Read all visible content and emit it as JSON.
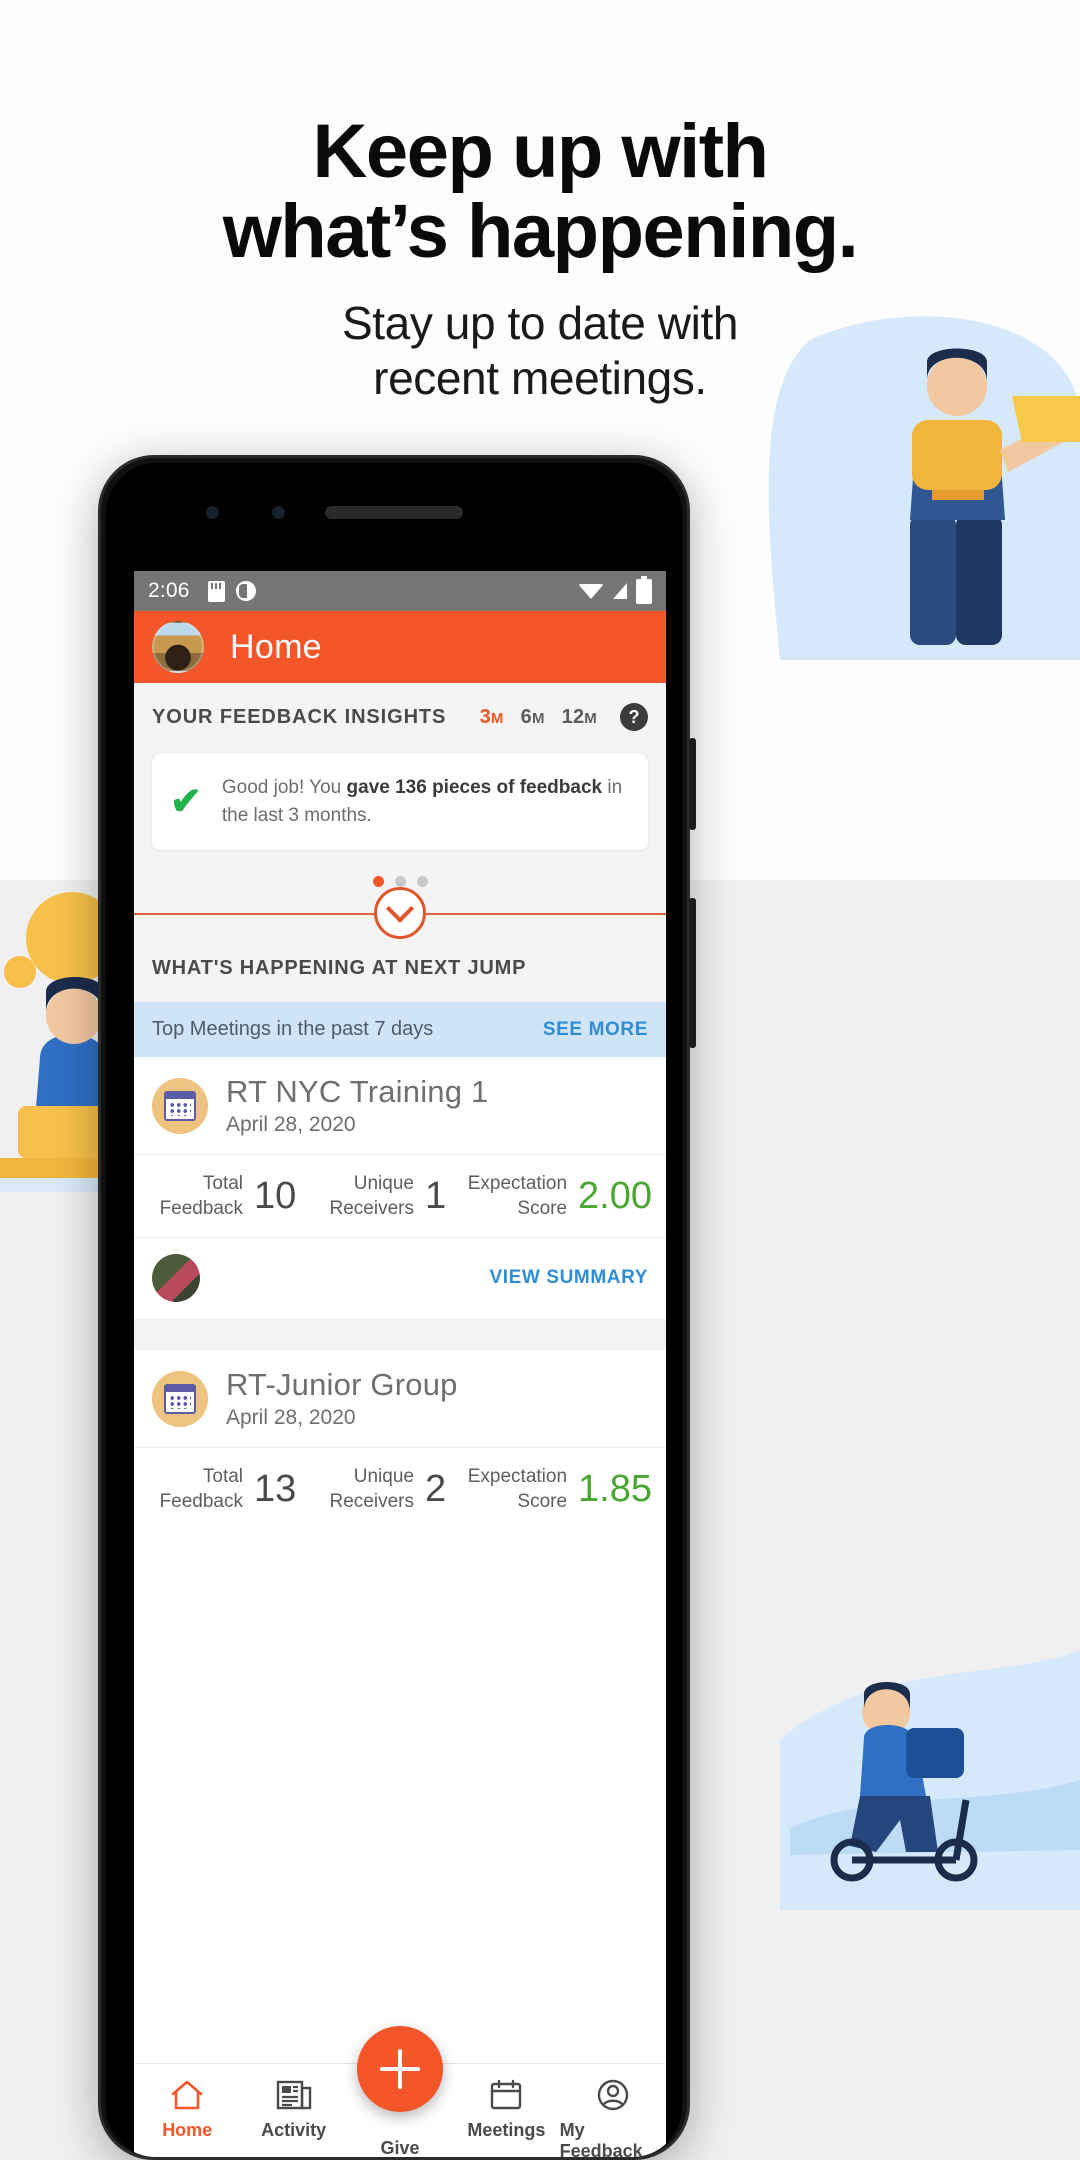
{
  "promo": {
    "headline_line1": "Keep up with",
    "headline_line2": "what’s happening.",
    "subhead_line1": "Stay up to date with",
    "subhead_line2": "recent meetings."
  },
  "colors": {
    "brand_orange": "#f4562a",
    "link_blue": "#2f8cd6",
    "success_green": "#21b24b",
    "score_green": "#4aa832",
    "banner_blue": "#cfe5f7",
    "calendar_tan": "#edc37f"
  },
  "phone": {
    "statusbar": {
      "time": "2:06",
      "left_icons": [
        "sd-card-icon",
        "do-not-disturb-icon"
      ],
      "right_icons": [
        "wifi-icon",
        "signal-icon",
        "battery-icon"
      ]
    },
    "appbar": {
      "title": "Home",
      "avatar": "user-avatar"
    },
    "insights": {
      "title": "YOUR FEEDBACK INSIGHTS",
      "ranges": [
        {
          "num": "3",
          "unit": "M",
          "active": true
        },
        {
          "num": "6",
          "unit": "M",
          "active": false
        },
        {
          "num": "12",
          "unit": "M",
          "active": false
        }
      ],
      "help_label": "?",
      "card": {
        "icon": "check-icon",
        "text_before": "Good job! You ",
        "text_bold": "gave 136 pieces of feedback",
        "text_after": " in the last 3 months."
      },
      "dots": [
        true,
        false,
        false
      ]
    },
    "expander": {
      "icon": "chevron-down-icon"
    },
    "happening": {
      "title": "WHAT'S HAPPENING AT NEXT JUMP",
      "banner_label": "Top Meetings in the past 7 days",
      "banner_action": "SEE MORE"
    },
    "meetings": [
      {
        "icon": "calendar-icon",
        "name": "RT NYC Training 1",
        "date": "April 28, 2020",
        "stats": [
          {
            "label_line1": "Total",
            "label_line2": "Feedback",
            "value": "10"
          },
          {
            "label_line1": "Unique",
            "label_line2": "Receivers",
            "value": "1"
          },
          {
            "label_line1": "Expectation",
            "label_line2": "Score",
            "value": "2.00"
          }
        ],
        "footer_action": "VIEW SUMMARY",
        "footer_avatar": "participant-avatar"
      },
      {
        "icon": "calendar-icon",
        "name": "RT-Junior Group",
        "date": "April 28, 2020",
        "stats": [
          {
            "label_line1": "Total",
            "label_line2": "Feedback",
            "value": "13"
          },
          {
            "label_line1": "Unique",
            "label_line2": "Receivers",
            "value": "2"
          },
          {
            "label_line1": "Expectation",
            "label_line2": "Score",
            "value": "1.85"
          }
        ]
      }
    ],
    "bottomnav": {
      "items": [
        {
          "label": "Home",
          "icon": "home-icon",
          "active": true
        },
        {
          "label": "Activity",
          "icon": "newspaper-icon",
          "active": false
        },
        {
          "label": "Give",
          "icon": "plus-icon",
          "active": false
        },
        {
          "label": "Meetings",
          "icon": "calendar-icon",
          "active": false
        },
        {
          "label": "My Feedback",
          "icon": "account-circle-icon",
          "active": false
        }
      ]
    }
  }
}
